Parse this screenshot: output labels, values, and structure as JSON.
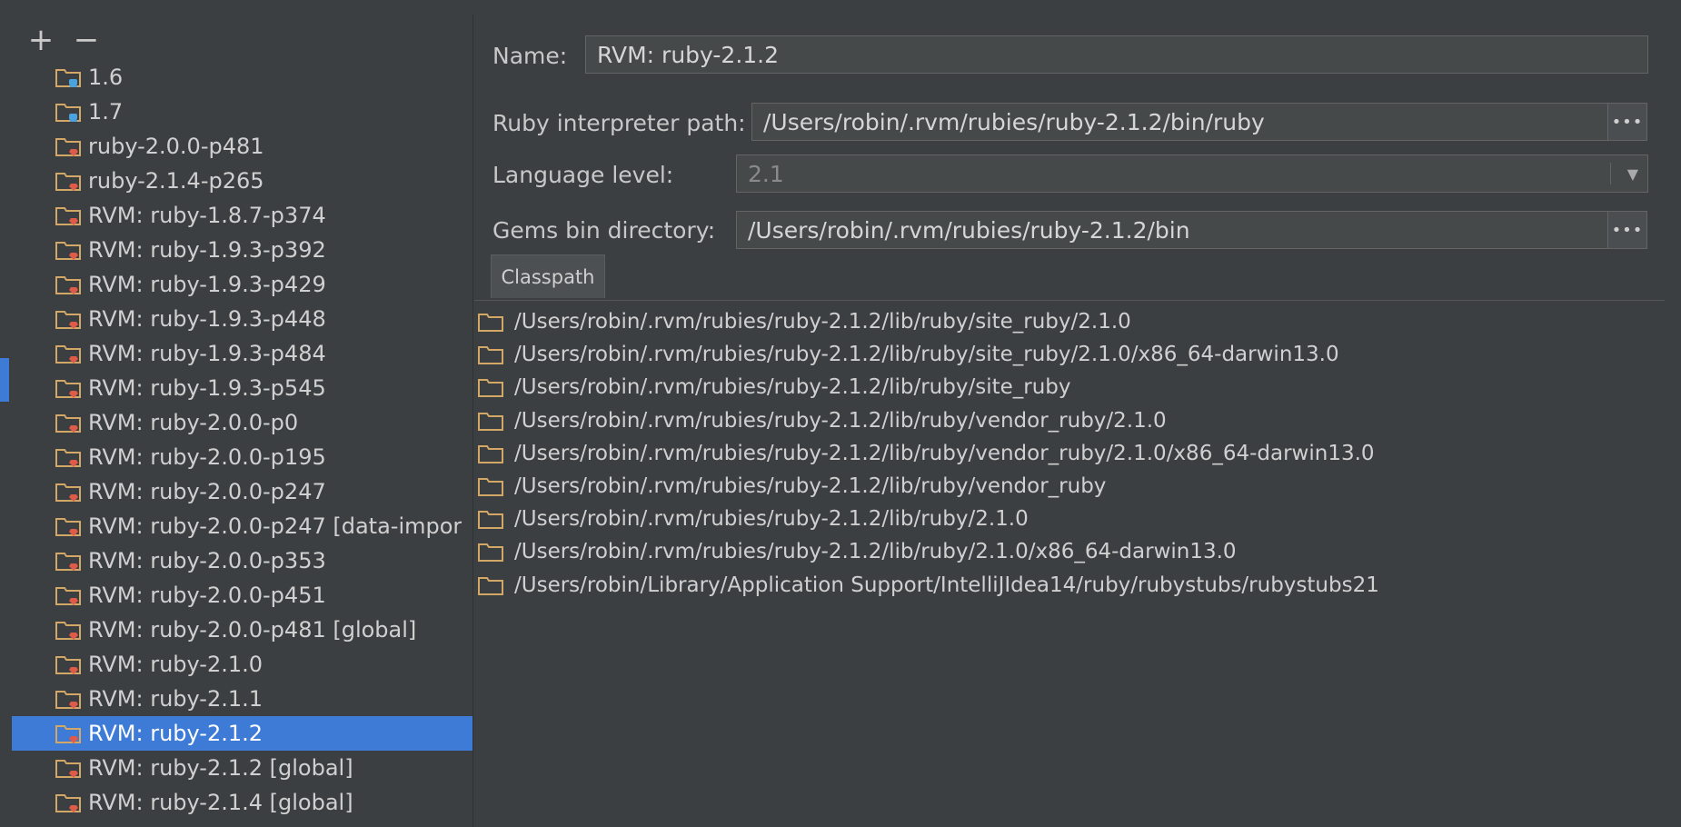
{
  "toolbar": {
    "add_label": "+",
    "remove_label": "−"
  },
  "sdks": [
    {
      "label": "1.6",
      "badge": "java"
    },
    {
      "label": "1.7",
      "badge": "java"
    },
    {
      "label": "ruby-2.0.0-p481",
      "badge": "ruby"
    },
    {
      "label": "ruby-2.1.4-p265",
      "badge": "ruby"
    },
    {
      "label": "RVM: ruby-1.8.7-p374",
      "badge": "ruby"
    },
    {
      "label": "RVM: ruby-1.9.3-p392",
      "badge": "ruby"
    },
    {
      "label": "RVM: ruby-1.9.3-p429",
      "badge": "ruby"
    },
    {
      "label": "RVM: ruby-1.9.3-p448",
      "badge": "ruby"
    },
    {
      "label": "RVM: ruby-1.9.3-p484",
      "badge": "ruby"
    },
    {
      "label": "RVM: ruby-1.9.3-p545",
      "badge": "ruby"
    },
    {
      "label": "RVM: ruby-2.0.0-p0",
      "badge": "ruby"
    },
    {
      "label": "RVM: ruby-2.0.0-p195",
      "badge": "ruby"
    },
    {
      "label": "RVM: ruby-2.0.0-p247",
      "badge": "ruby"
    },
    {
      "label": "RVM: ruby-2.0.0-p247 [data-impor",
      "badge": "ruby"
    },
    {
      "label": "RVM: ruby-2.0.0-p353",
      "badge": "ruby"
    },
    {
      "label": "RVM: ruby-2.0.0-p451",
      "badge": "ruby"
    },
    {
      "label": "RVM: ruby-2.0.0-p481 [global]",
      "badge": "ruby"
    },
    {
      "label": "RVM: ruby-2.1.0",
      "badge": "ruby"
    },
    {
      "label": "RVM: ruby-2.1.1",
      "badge": "ruby"
    },
    {
      "label": "RVM: ruby-2.1.2",
      "badge": "ruby",
      "selected": true
    },
    {
      "label": "RVM: ruby-2.1.2 [global]",
      "badge": "ruby"
    },
    {
      "label": "RVM: ruby-2.1.4 [global]",
      "badge": "ruby"
    }
  ],
  "form": {
    "name_label": "Name:",
    "name_value": "RVM: ruby-2.1.2",
    "interpreter_label": "Ruby interpreter path:",
    "interpreter_value": "/Users/robin/.rvm/rubies/ruby-2.1.2/bin/ruby",
    "language_label": "Language level:",
    "language_value": "2.1",
    "gems_label": "Gems bin directory:",
    "gems_value": "/Users/robin/.rvm/rubies/ruby-2.1.2/bin",
    "browse_label": "•••"
  },
  "tabs": [
    {
      "label": "Classpath"
    }
  ],
  "classpath": [
    "/Users/robin/.rvm/rubies/ruby-2.1.2/lib/ruby/site_ruby/2.1.0",
    "/Users/robin/.rvm/rubies/ruby-2.1.2/lib/ruby/site_ruby/2.1.0/x86_64-darwin13.0",
    "/Users/robin/.rvm/rubies/ruby-2.1.2/lib/ruby/site_ruby",
    "/Users/robin/.rvm/rubies/ruby-2.1.2/lib/ruby/vendor_ruby/2.1.0",
    "/Users/robin/.rvm/rubies/ruby-2.1.2/lib/ruby/vendor_ruby/2.1.0/x86_64-darwin13.0",
    "/Users/robin/.rvm/rubies/ruby-2.1.2/lib/ruby/vendor_ruby",
    "/Users/robin/.rvm/rubies/ruby-2.1.2/lib/ruby/2.1.0",
    "/Users/robin/.rvm/rubies/ruby-2.1.2/lib/ruby/2.1.0/x86_64-darwin13.0",
    "/Users/robin/Library/Application Support/IntelliJIdea14/ruby/rubystubs/rubystubs21"
  ],
  "colors": {
    "accent": "#3d7bd6",
    "folder": "#d3a765",
    "ruby_badge": "#e05a4a",
    "java_badge": "#4aa3df"
  }
}
